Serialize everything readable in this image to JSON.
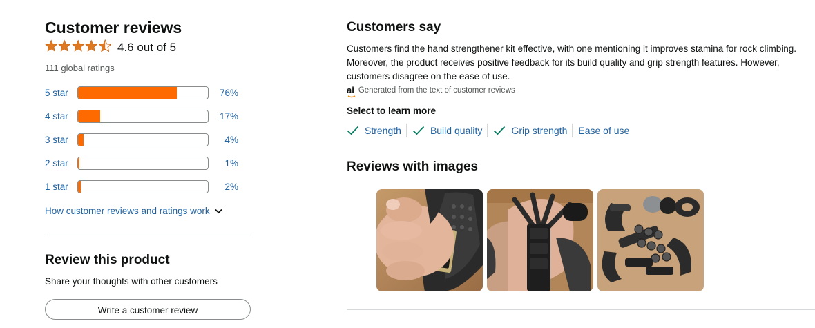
{
  "reviews": {
    "title": "Customer reviews",
    "rating_value": 4.6,
    "rating_text": "4.6 out of 5",
    "global_ratings": "111 global ratings",
    "histogram": [
      {
        "label": "5 star",
        "pct_text": "76%",
        "pct": 76
      },
      {
        "label": "4 star",
        "pct_text": "17%",
        "pct": 17
      },
      {
        "label": "3 star",
        "pct_text": "4%",
        "pct": 4
      },
      {
        "label": "2 star",
        "pct_text": "1%",
        "pct": 1
      },
      {
        "label": "1 star",
        "pct_text": "2%",
        "pct": 2
      }
    ],
    "how_link": "How customer reviews and ratings work"
  },
  "review_product": {
    "title": "Review this product",
    "subtitle": "Share your thoughts with other customers",
    "button": "Write a customer review"
  },
  "customers_say": {
    "title": "Customers say",
    "summary": "Customers find the hand strengthener kit effective, with one mentioning it improves stamina for rock climbing. Moreover, the product receives positive feedback for its build quality and grip strength features. However, customers disagree on the ease of use.",
    "generated_note": "Generated from the text of customer reviews",
    "ai_badge": "ai",
    "select_label": "Select to learn more",
    "aspects": [
      {
        "label": "Strength",
        "positive": true
      },
      {
        "label": "Build quality",
        "positive": true
      },
      {
        "label": "Grip strength",
        "positive": true
      },
      {
        "label": "Ease of use",
        "positive": false
      }
    ]
  },
  "review_images": {
    "title": "Reviews with images",
    "images": [
      {
        "icon": "hand-gripper-photo"
      },
      {
        "icon": "finger-exerciser-photo"
      },
      {
        "icon": "kit-parts-photo"
      }
    ]
  },
  "colors": {
    "star": "#de7921",
    "bar_fill": "#ff6a00",
    "link": "#2162a1",
    "check": "#067d62"
  }
}
